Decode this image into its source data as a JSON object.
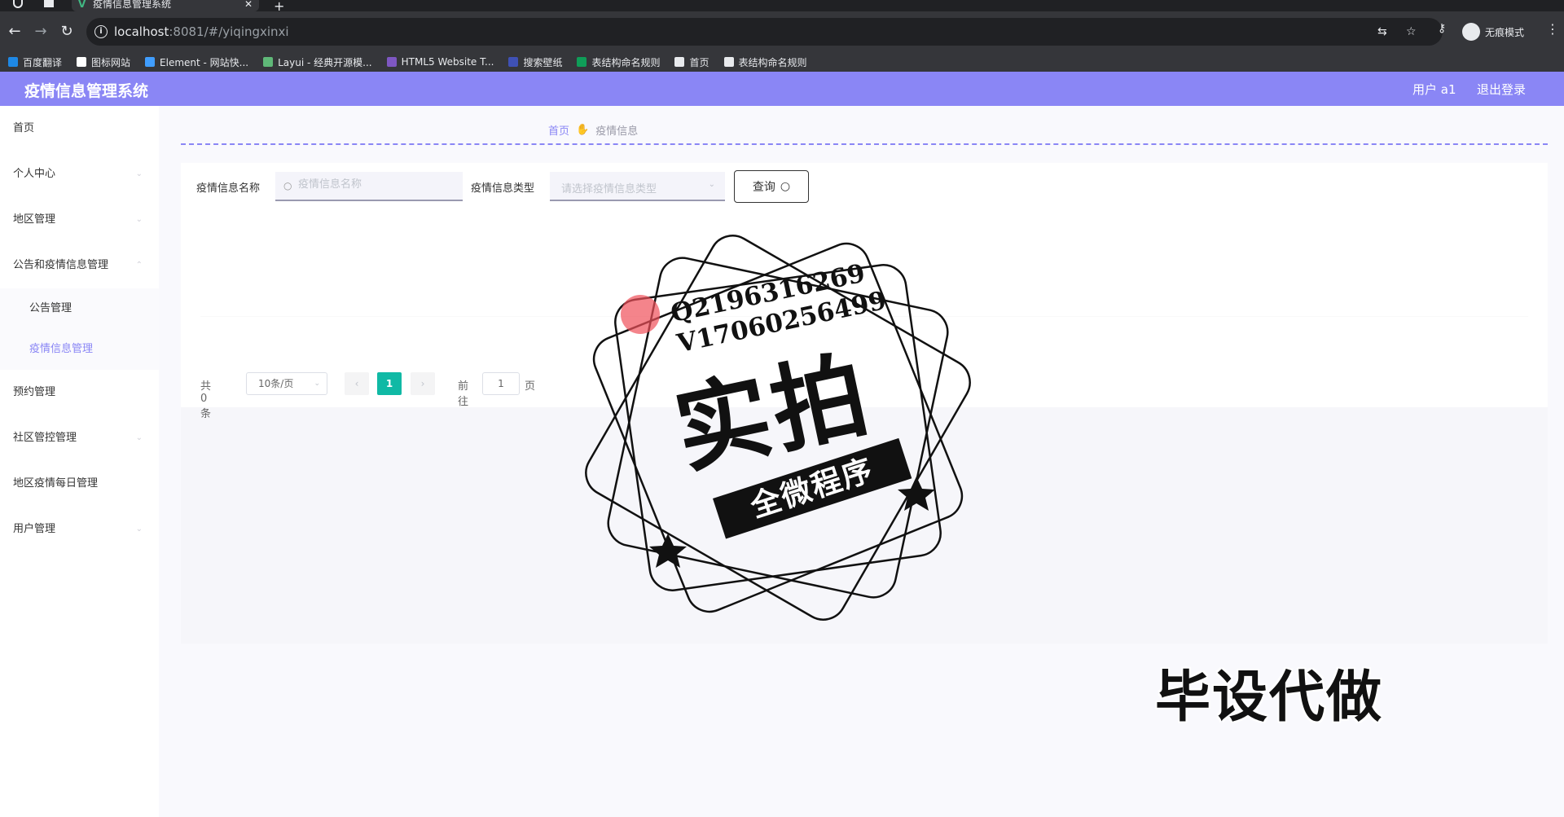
{
  "browser": {
    "tab_title": "疫情信息管理系统",
    "url_host": "localhost",
    "url_rest": ":8081/#/yiqingxinxi",
    "incognito_label": "无痕模式",
    "bookmarks": [
      {
        "label": "百度翻译",
        "color": "#1e88e5"
      },
      {
        "label": "图标网站",
        "color": "#ffffff"
      },
      {
        "label": "Element - 网站快...",
        "color": "#409eff"
      },
      {
        "label": "Layui - 经典开源模...",
        "color": "#5fb878"
      },
      {
        "label": "HTML5 Website T...",
        "color": "#7e57c2"
      },
      {
        "label": "搜索壁纸",
        "color": "#3f51b5"
      },
      {
        "label": "表结构命名规则",
        "color": "#0f9d58"
      },
      {
        "label": "首页",
        "color": "#e8eaed"
      },
      {
        "label": "表结构命名规则",
        "color": "#e8eaed"
      }
    ]
  },
  "header": {
    "title": "疫情信息管理系统",
    "user": "用户 a1",
    "logout": "退出登录"
  },
  "sidebar": {
    "items": [
      {
        "label": "首页"
      },
      {
        "label": "个人中心"
      },
      {
        "label": "地区管理"
      },
      {
        "label": "公告和疫情信息管理"
      },
      {
        "label": "公告管理"
      },
      {
        "label": "疫情信息管理"
      },
      {
        "label": "预约管理"
      },
      {
        "label": "社区管控管理"
      },
      {
        "label": "地区疫情每日管理"
      },
      {
        "label": "用户管理"
      }
    ]
  },
  "breadcrumb": {
    "home": "首页",
    "current": "疫情信息"
  },
  "search": {
    "name_label": "疫情信息名称",
    "name_placeholder": "疫情信息名称",
    "type_label": "疫情信息类型",
    "type_placeholder": "请选择疫情信息类型",
    "query_button": "查询"
  },
  "pagination": {
    "total": "共 0 条",
    "page_size": "10条/页",
    "current_page": "1",
    "goto_label": "前往",
    "goto_value": "1",
    "page_suffix": "页"
  },
  "watermark": {
    "qq": "Q2196316269",
    "vx": "V17060256499",
    "big": "实拍",
    "ribbon": "全微程序",
    "corner": "毕设代做"
  }
}
